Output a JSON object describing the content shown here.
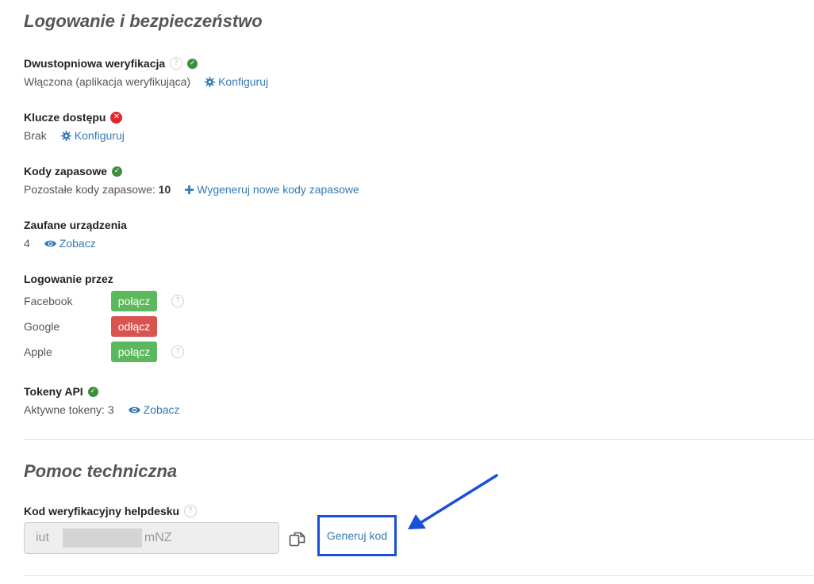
{
  "login_security": {
    "heading": "Logowanie i bezpieczeństwo",
    "two_factor": {
      "title": "Dwustopniowa weryfikacja",
      "status": "Włączona (aplikacja weryfikująca)",
      "action": "Konfiguruj"
    },
    "passkeys": {
      "title": "Klucze dostępu",
      "status": "Brak",
      "action": "Konfiguruj"
    },
    "backup_codes": {
      "title": "Kody zapasowe",
      "label": "Pozostałe kody zapasowe:",
      "count": "10",
      "action": "Wygeneruj nowe kody zapasowe"
    },
    "trusted_devices": {
      "title": "Zaufane urządzenia",
      "count": "4",
      "action": "Zobacz"
    },
    "social_login": {
      "title": "Logowanie przez",
      "providers": [
        {
          "name": "Facebook",
          "button": "połącz"
        },
        {
          "name": "Google",
          "button": "odłącz"
        },
        {
          "name": "Apple",
          "button": "połącz"
        }
      ]
    },
    "api_tokens": {
      "title": "Tokeny API",
      "label": "Aktywne tokeny: 3",
      "action": "Zobacz"
    }
  },
  "support": {
    "heading": "Pomoc techniczna",
    "helpdesk_code": {
      "title": "Kod weryfikacyjny helpdesku",
      "value_prefix": "iut",
      "value_suffix": "mNZ",
      "generate_label": "Generuj kod"
    }
  },
  "colors": {
    "link": "#337ab7",
    "success": "#5cb85c",
    "danger": "#d9534f",
    "annotation": "#1a4fd8"
  },
  "icons": {
    "help": "question-circle-icon",
    "ok": "check-circle-icon",
    "error": "x-circle-icon",
    "configure": "gear-icon",
    "add": "plus-icon",
    "view": "eye-icon",
    "copy": "copy-icon"
  }
}
